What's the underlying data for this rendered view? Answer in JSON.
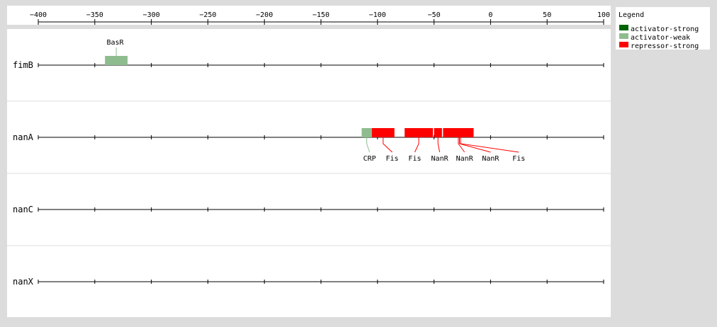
{
  "axis": {
    "min": -400,
    "max": 100,
    "ticks": [
      -400,
      -350,
      -300,
      -250,
      -200,
      -150,
      -100,
      -50,
      0,
      50,
      100
    ],
    "tick_labels": [
      "−400",
      "−350",
      "−300",
      "−250",
      "−200",
      "−150",
      "−100",
      "−50",
      "0",
      "50",
      "100"
    ]
  },
  "legend": {
    "title": "Legend",
    "items": [
      {
        "label": "activator-strong",
        "color": "#006400"
      },
      {
        "label": "activator-weak",
        "color": "#8fbc8f"
      },
      {
        "label": "repressor-strong",
        "color": "#ff0000"
      }
    ]
  },
  "genes": [
    {
      "name": "fimB",
      "sites": [
        {
          "label": "BasR",
          "start": -341,
          "end": -321,
          "type": "activator-weak",
          "label_at": -332,
          "label_side": "above"
        }
      ]
    },
    {
      "name": "nanA",
      "sites": [
        {
          "label": "CRP",
          "start": -114,
          "end": -105,
          "type": "activator-weak",
          "label_at": -107,
          "label_side": "below"
        },
        {
          "label": "Fis",
          "start": -105,
          "end": -85,
          "type": "repressor-strong",
          "label_at": -87,
          "label_side": "below"
        },
        {
          "label": "Fis",
          "start": -76,
          "end": -51,
          "type": "repressor-strong",
          "label_at": -67,
          "label_side": "below"
        },
        {
          "label": "NanR",
          "start": -50,
          "end": -43,
          "type": "repressor-strong",
          "label_at": -45,
          "label_side": "below"
        },
        {
          "label": "NanR",
          "start": -42,
          "end": -15,
          "type": "repressor-strong",
          "label_at": -23,
          "label_side": "below"
        },
        {
          "label": "NanR",
          "start": -40,
          "end": -15,
          "type": "repressor-strong",
          "label_at": 0,
          "label_side": "below"
        },
        {
          "label": "Fis",
          "start": -38,
          "end": -15,
          "type": "repressor-strong",
          "label_at": 25,
          "label_side": "below"
        }
      ]
    },
    {
      "name": "nanC",
      "sites": []
    },
    {
      "name": "nanX",
      "sites": []
    }
  ]
}
